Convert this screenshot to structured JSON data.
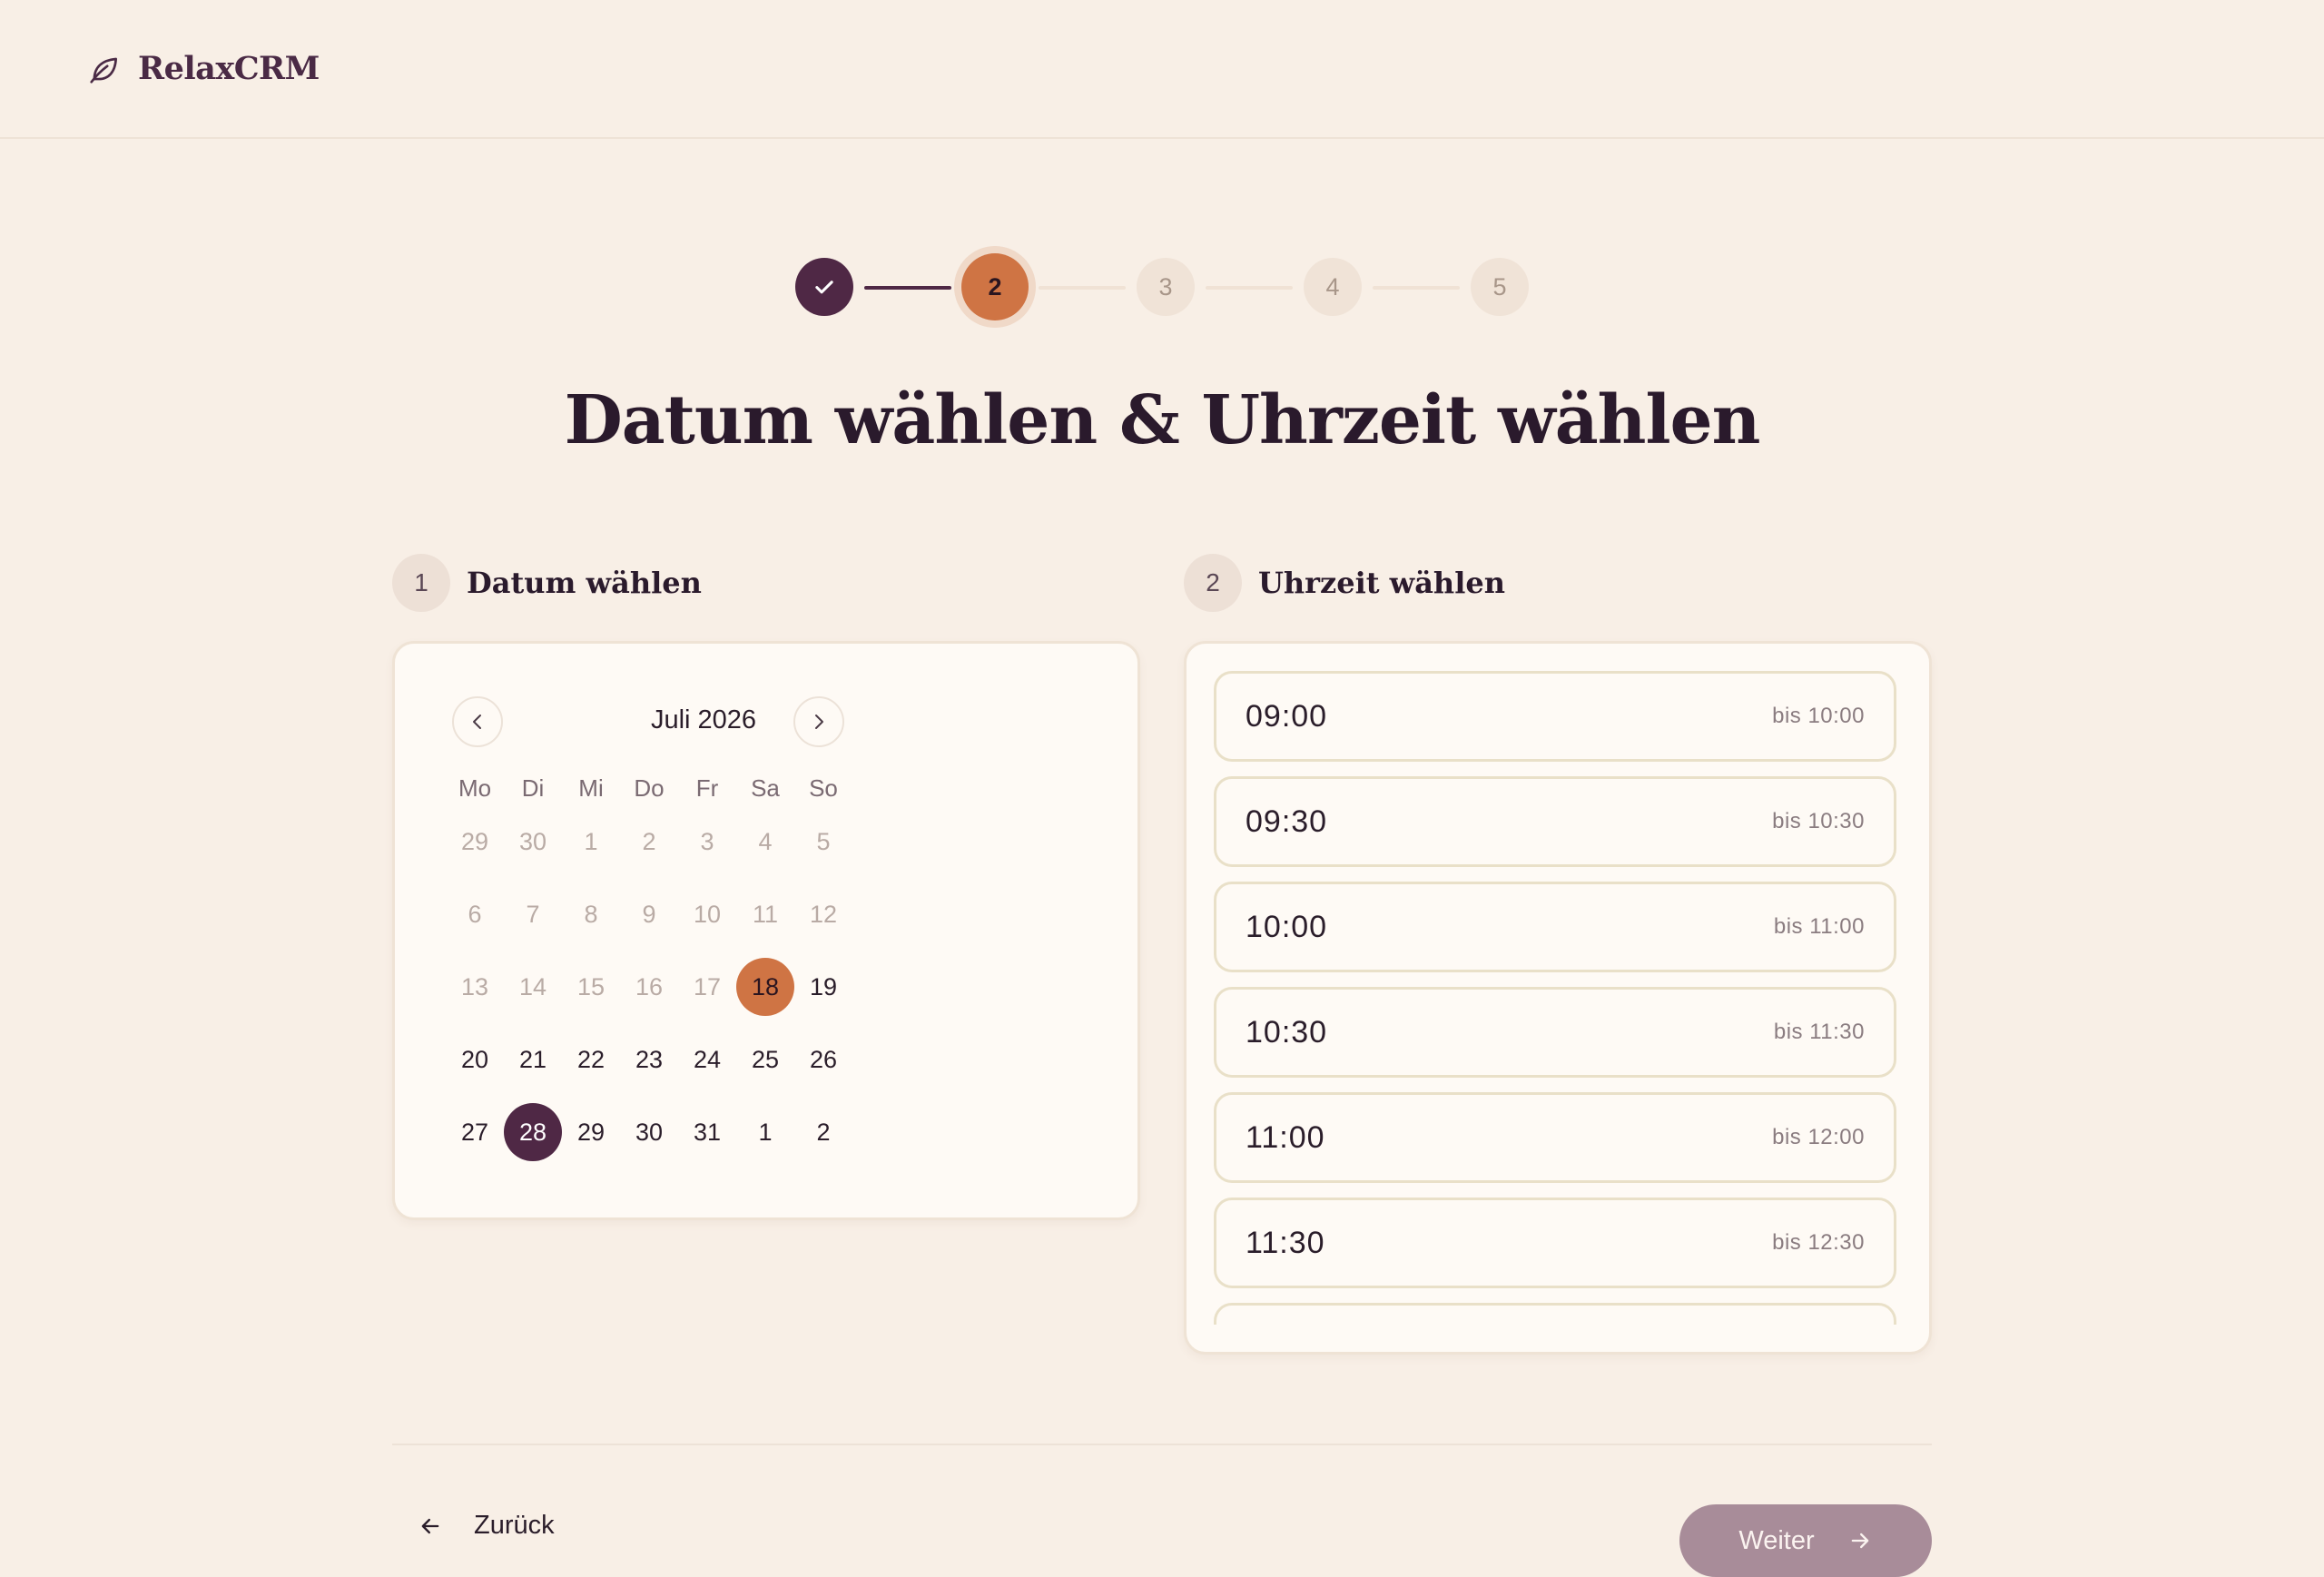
{
  "app": {
    "brand": "RelaxCRM"
  },
  "stepper": {
    "steps": [
      {
        "label": "",
        "state": "done"
      },
      {
        "label": "2",
        "state": "active"
      },
      {
        "label": "3",
        "state": "pending"
      },
      {
        "label": "4",
        "state": "pending"
      },
      {
        "label": "5",
        "state": "pending"
      }
    ]
  },
  "page_title": "Datum wählen & Uhrzeit wählen",
  "date_section": {
    "number": "1",
    "label": "Datum wählen"
  },
  "time_section": {
    "number": "2",
    "label": "Uhrzeit wählen"
  },
  "calendar": {
    "month": "Juli 2026",
    "weekdays": [
      "Mo",
      "Di",
      "Mi",
      "Do",
      "Fr",
      "Sa",
      "So"
    ],
    "weeks": [
      [
        {
          "d": "29",
          "s": "muted"
        },
        {
          "d": "30",
          "s": "muted"
        },
        {
          "d": "1",
          "s": "muted"
        },
        {
          "d": "2",
          "s": "muted"
        },
        {
          "d": "3",
          "s": "muted"
        },
        {
          "d": "4",
          "s": "muted"
        },
        {
          "d": "5",
          "s": "muted"
        }
      ],
      [
        {
          "d": "6",
          "s": "muted"
        },
        {
          "d": "7",
          "s": "muted"
        },
        {
          "d": "8",
          "s": "muted"
        },
        {
          "d": "9",
          "s": "muted"
        },
        {
          "d": "10",
          "s": "muted"
        },
        {
          "d": "11",
          "s": "muted"
        },
        {
          "d": "12",
          "s": "muted"
        }
      ],
      [
        {
          "d": "13",
          "s": "muted"
        },
        {
          "d": "14",
          "s": "muted"
        },
        {
          "d": "15",
          "s": "muted"
        },
        {
          "d": "16",
          "s": "muted"
        },
        {
          "d": "17",
          "s": "muted"
        },
        {
          "d": "18",
          "s": "today"
        },
        {
          "d": "19",
          "s": "normal"
        }
      ],
      [
        {
          "d": "20",
          "s": "normal"
        },
        {
          "d": "21",
          "s": "normal"
        },
        {
          "d": "22",
          "s": "normal"
        },
        {
          "d": "23",
          "s": "normal"
        },
        {
          "d": "24",
          "s": "normal"
        },
        {
          "d": "25",
          "s": "normal"
        },
        {
          "d": "26",
          "s": "normal"
        }
      ],
      [
        {
          "d": "27",
          "s": "normal"
        },
        {
          "d": "28",
          "s": "selected"
        },
        {
          "d": "29",
          "s": "normal"
        },
        {
          "d": "30",
          "s": "normal"
        },
        {
          "d": "31",
          "s": "normal"
        },
        {
          "d": "1",
          "s": "normal"
        },
        {
          "d": "2",
          "s": "normal"
        }
      ]
    ]
  },
  "time_slots": [
    {
      "time": "09:00",
      "end": "bis 10:00"
    },
    {
      "time": "09:30",
      "end": "bis 10:30"
    },
    {
      "time": "10:00",
      "end": "bis 11:00"
    },
    {
      "time": "10:30",
      "end": "bis 11:30"
    },
    {
      "time": "11:00",
      "end": "bis 12:00"
    },
    {
      "time": "11:30",
      "end": "bis 12:30"
    },
    {
      "time": "",
      "end": ""
    }
  ],
  "footer": {
    "back_label": "Zurück",
    "next_label": "Weiter"
  },
  "colors": {
    "primary": "#4f2845",
    "accent": "#cf7444",
    "background": "#f8efe6",
    "next_disabled": "#a88c99"
  },
  "icons": {
    "logo": "leaf-icon",
    "done_step": "check-icon",
    "prev_month": "chevron-left-icon",
    "next_month": "chevron-right-icon",
    "back": "arrow-left-icon",
    "next": "arrow-right-icon"
  }
}
